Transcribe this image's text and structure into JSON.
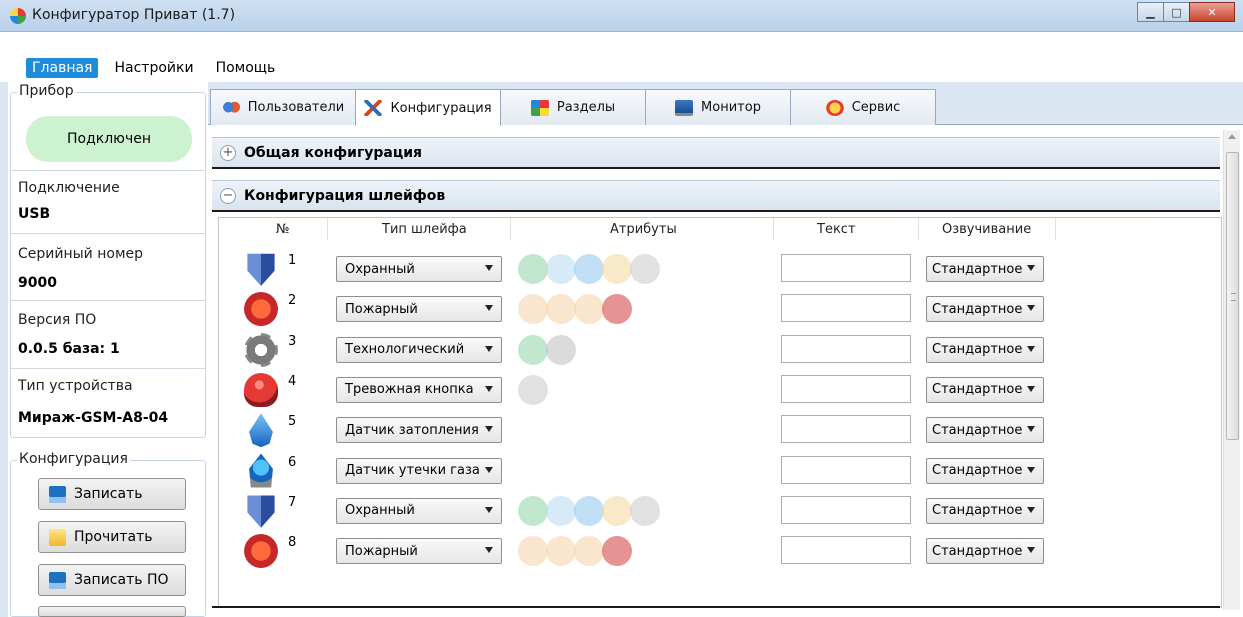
{
  "window": {
    "title": "Конфигуратор Приват (1.7)"
  },
  "menu": {
    "items": [
      "Главная",
      "Настройки",
      "Помощь"
    ]
  },
  "left": {
    "device_group": "Прибор",
    "status": "Подключен",
    "connection_label": "Подключение",
    "connection_value": "USB",
    "serial_label": "Серийный номер",
    "serial_value": "9000",
    "fw_label": "Версия ПО",
    "fw_value": "0.0.5 база: 1",
    "type_label": "Тип устройства",
    "type_value": "Мираж-GSM-A8-04",
    "config_group": "Конфигурация",
    "buttons": [
      "Записать",
      "Прочитать",
      "Записать ПО"
    ]
  },
  "tabs": [
    "Пользователи",
    "Конфигурация",
    "Разделы",
    "Монитор",
    "Сервис"
  ],
  "sections": {
    "general": "Общая конфигурация",
    "loops": "Конфигурация шлейфов"
  },
  "table": {
    "headers": [
      "№",
      "Тип шлейфа",
      "Атрибуты",
      "Текст",
      "Озвучивание"
    ],
    "rows": [
      {
        "num": "1",
        "type": "Охранный",
        "sound": "Стандартное",
        "icon": "shield-icon"
      },
      {
        "num": "2",
        "type": "Пожарный",
        "sound": "Стандартное",
        "icon": "fire-icon"
      },
      {
        "num": "3",
        "type": "Технологический",
        "sound": "Стандартное",
        "icon": "gear-icon"
      },
      {
        "num": "4",
        "type": "Тревожная кнопка",
        "sound": "Стандартное",
        "icon": "alarm-button-icon"
      },
      {
        "num": "5",
        "type": "Датчик затопления",
        "sound": "Стандартное",
        "icon": "water-drop-icon"
      },
      {
        "num": "6",
        "type": "Датчик утечки газа",
        "sound": "Стандартное",
        "icon": "gas-flame-icon"
      },
      {
        "num": "7",
        "type": "Охранный",
        "sound": "Стандартное",
        "icon": "shield-icon"
      },
      {
        "num": "8",
        "type": "Пожарный",
        "sound": "Стандартное",
        "icon": "fire-icon"
      }
    ]
  }
}
